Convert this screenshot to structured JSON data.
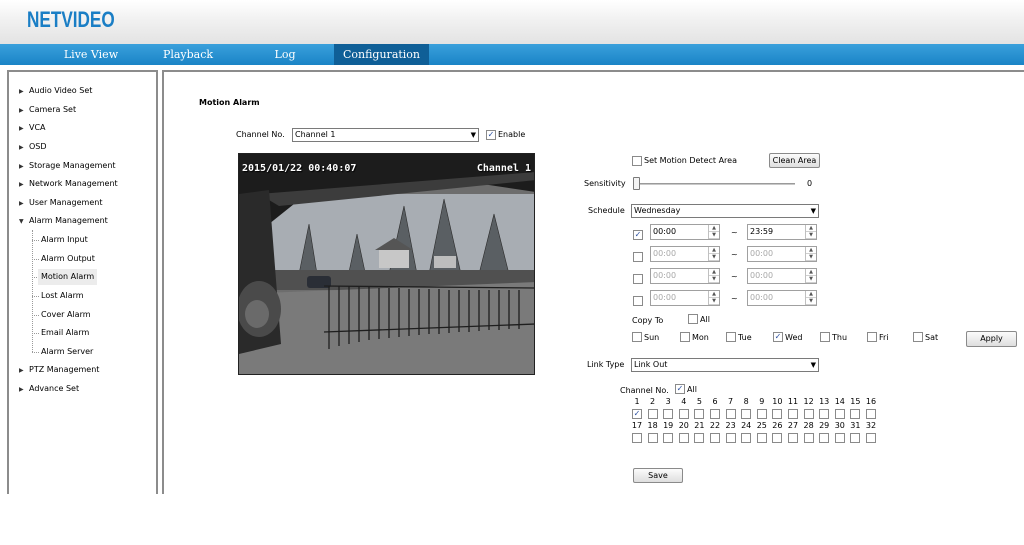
{
  "brand": {
    "logo_text": "NETVIDEO",
    "color": "#1a7ec5"
  },
  "nav": {
    "items": [
      {
        "label": "Live View"
      },
      {
        "label": "Playback"
      },
      {
        "label": "Log"
      },
      {
        "label": "Configuration"
      }
    ],
    "active": "Configuration"
  },
  "sidebar": {
    "items": [
      {
        "label": "Audio Video Set",
        "expanded": false
      },
      {
        "label": "Camera Set",
        "expanded": false
      },
      {
        "label": "VCA",
        "expanded": false
      },
      {
        "label": "OSD",
        "expanded": false
      },
      {
        "label": "Storage Management",
        "expanded": false
      },
      {
        "label": "Network Management",
        "expanded": false
      },
      {
        "label": "User Management",
        "expanded": false
      },
      {
        "label": "Alarm Management",
        "expanded": true
      },
      {
        "label": "PTZ Management",
        "expanded": false
      },
      {
        "label": "Advance Set",
        "expanded": false
      }
    ],
    "alarm_children": [
      {
        "label": "Alarm Input"
      },
      {
        "label": "Alarm Output"
      },
      {
        "label": "Motion Alarm",
        "selected": true
      },
      {
        "label": "Lost Alarm"
      },
      {
        "label": "Cover Alarm"
      },
      {
        "label": "Email Alarm"
      },
      {
        "label": "Alarm Server"
      }
    ]
  },
  "page": {
    "title": "Motion Alarm",
    "channel_label": "Channel No.",
    "channel_value": "Channel 1",
    "enable_label": "Enable",
    "enable_checked": true,
    "video_osd": {
      "datetime": "2015/01/22 00:40:07",
      "channel": "Channel 1"
    },
    "set_area_label": "Set Motion Detect Area",
    "set_area_checked": false,
    "clean_area_label": "Clean Area",
    "sensitivity_label": "Sensitivity",
    "sensitivity_value": "0",
    "schedule_label": "Schedule",
    "schedule_value": "Wednesday",
    "time_rows": [
      {
        "checked": true,
        "start": "00:00",
        "end": "23:59",
        "enabled": true
      },
      {
        "checked": false,
        "start": "00:00",
        "end": "00:00",
        "enabled": false
      },
      {
        "checked": false,
        "start": "00:00",
        "end": "00:00",
        "enabled": false
      },
      {
        "checked": false,
        "start": "00:00",
        "end": "00:00",
        "enabled": false
      }
    ],
    "tilde": "~",
    "copy_to_label": "Copy To",
    "all_label": "All",
    "days": [
      {
        "label": "Sun",
        "checked": false
      },
      {
        "label": "Mon",
        "checked": false
      },
      {
        "label": "Tue",
        "checked": false
      },
      {
        "label": "Wed",
        "checked": true
      },
      {
        "label": "Thu",
        "checked": false
      },
      {
        "label": "Fri",
        "checked": false
      },
      {
        "label": "Sat",
        "checked": false
      }
    ],
    "apply_label": "Apply",
    "link_type_label": "Link Type",
    "link_type_value": "Link Out",
    "link_channel_label": "Channel No.",
    "link_all_label": "All",
    "link_all_checked": true,
    "channels_row1": [
      "1",
      "2",
      "3",
      "4",
      "5",
      "6",
      "7",
      "8",
      "9",
      "10",
      "11",
      "12",
      "13",
      "14",
      "15",
      "16"
    ],
    "channels_row2": [
      "17",
      "18",
      "19",
      "20",
      "21",
      "22",
      "23",
      "24",
      "25",
      "26",
      "27",
      "28",
      "29",
      "30",
      "31",
      "32"
    ],
    "checked_channels": [
      "1"
    ],
    "save_label": "Save"
  }
}
